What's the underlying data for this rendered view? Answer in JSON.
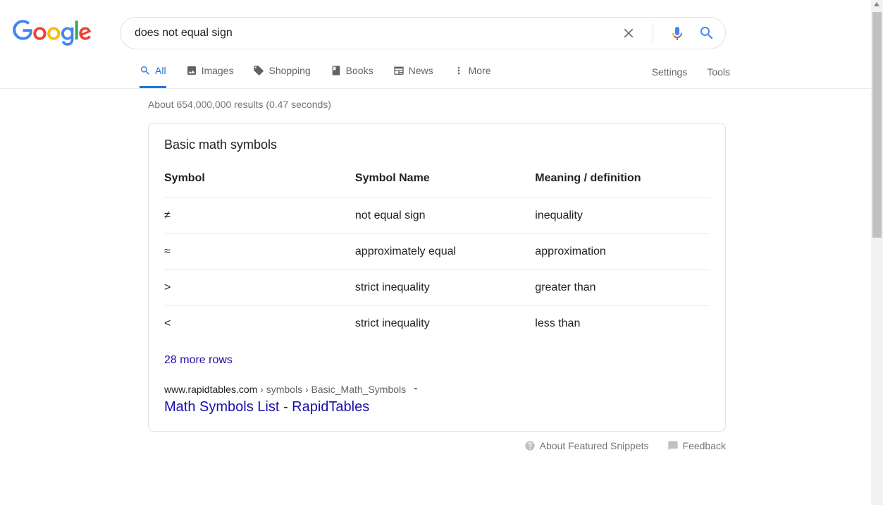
{
  "search": {
    "query": "does not equal sign"
  },
  "tabs": {
    "all": "All",
    "images": "Images",
    "shopping": "Shopping",
    "books": "Books",
    "news": "News",
    "more": "More"
  },
  "tools": {
    "settings": "Settings",
    "tools": "Tools"
  },
  "stats": "About 654,000,000 results (0.47 seconds)",
  "featured": {
    "title": "Basic math symbols",
    "headers": {
      "c1": "Symbol",
      "c2": "Symbol Name",
      "c3": "Meaning / definition"
    },
    "rows": [
      {
        "sym": "≠",
        "name": "not equal sign",
        "mean": "inequality"
      },
      {
        "sym": "≈",
        "name": "approximately equal",
        "mean": "approximation"
      },
      {
        "sym": ">",
        "name": "strict inequality",
        "mean": "greater than"
      },
      {
        "sym": "<",
        "name": "strict inequality",
        "mean": "less than"
      }
    ],
    "more": "28 more rows",
    "cite": {
      "domain": "www.rapidtables.com",
      "path": " › symbols › Basic_Math_Symbols"
    },
    "resultTitle": "Math Symbols List - RapidTables"
  },
  "footer": {
    "about": "About Featured Snippets",
    "feedback": "Feedback"
  }
}
